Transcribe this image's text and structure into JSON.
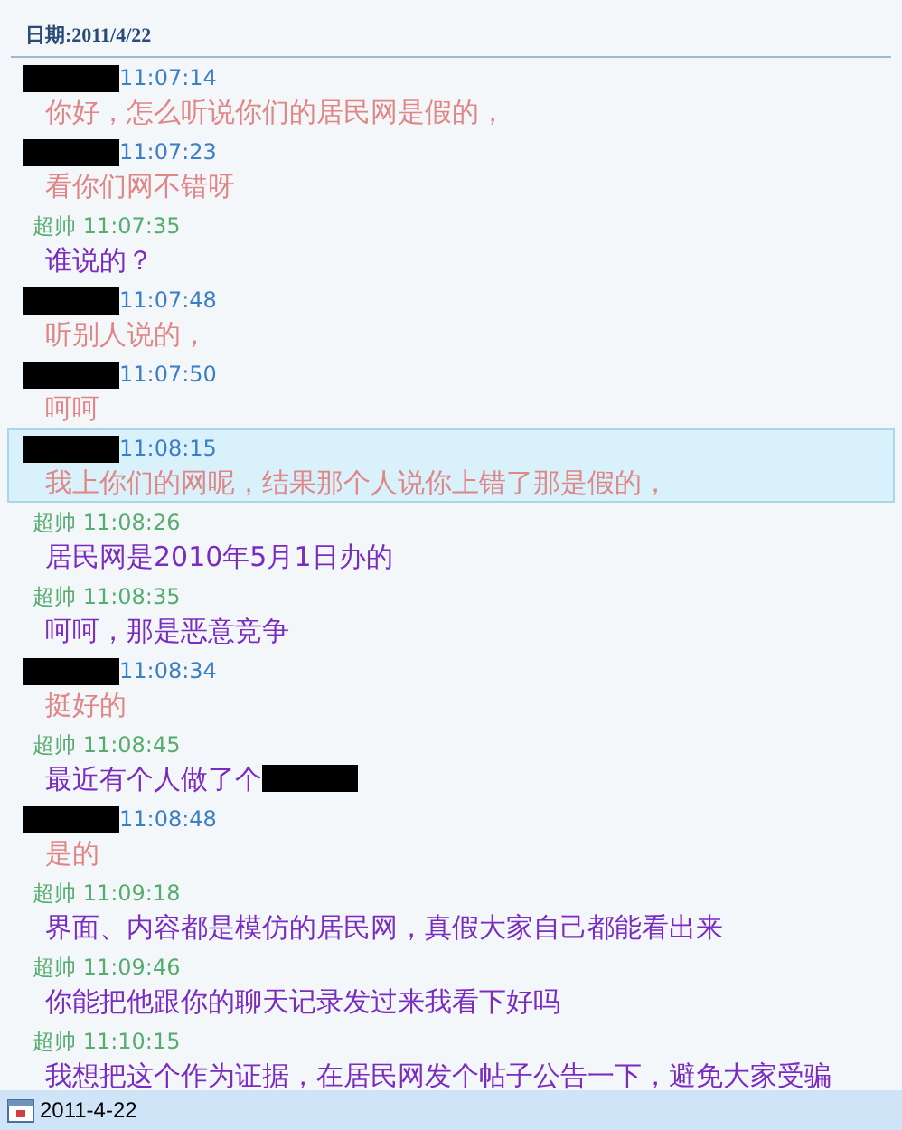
{
  "header": {
    "date_label": "日期:2011/4/22"
  },
  "messages": [
    {
      "kind": "them",
      "time": "11:07:14",
      "text": "你好，怎么听说你们的居民网是假的，",
      "selected": false,
      "redacted_tail": false
    },
    {
      "kind": "them",
      "time": "11:07:23",
      "text": "看你们网不错呀",
      "selected": false,
      "redacted_tail": false
    },
    {
      "kind": "me",
      "sender": "超帅",
      "time": "11:07:35",
      "text": "谁说的？",
      "selected": false,
      "redacted_tail": false
    },
    {
      "kind": "them",
      "time": "11:07:48",
      "text": "听别人说的，",
      "selected": false,
      "redacted_tail": false
    },
    {
      "kind": "them",
      "time": "11:07:50",
      "text": "呵呵",
      "selected": false,
      "redacted_tail": false
    },
    {
      "kind": "them",
      "time": "11:08:15",
      "text": "我上你们的网呢，结果那个人说你上错了那是假的，",
      "selected": true,
      "redacted_tail": false
    },
    {
      "kind": "me",
      "sender": "超帅",
      "time": "11:08:26",
      "text": "居民网是2010年5月1日办的",
      "selected": false,
      "redacted_tail": false
    },
    {
      "kind": "me",
      "sender": "超帅",
      "time": "11:08:35",
      "text": "呵呵，那是恶意竞争",
      "selected": false,
      "redacted_tail": false
    },
    {
      "kind": "them",
      "time": "11:08:34",
      "text": "挺好的",
      "selected": false,
      "redacted_tail": false
    },
    {
      "kind": "me",
      "sender": "超帅",
      "time": "11:08:45",
      "text": "最近有个人做了个",
      "selected": false,
      "redacted_tail": true
    },
    {
      "kind": "them",
      "time": "11:08:48",
      "text": "是的",
      "selected": false,
      "redacted_tail": false
    },
    {
      "kind": "me",
      "sender": "超帅",
      "time": "11:09:18",
      "text": "界面、内容都是模仿的居民网，真假大家自己都能看出来",
      "selected": false,
      "redacted_tail": false
    },
    {
      "kind": "me",
      "sender": "超帅",
      "time": "11:09:46",
      "text": "你能把他跟你的聊天记录发过来我看下好吗",
      "selected": false,
      "redacted_tail": false
    },
    {
      "kind": "me",
      "sender": "超帅",
      "time": "11:10:15",
      "text": "我想把这个作为证据，在居民网发个帖子公告一下，避免大家受骗",
      "selected": false,
      "redacted_tail": false
    }
  ],
  "status_bar": {
    "date": "2011-4-22"
  }
}
